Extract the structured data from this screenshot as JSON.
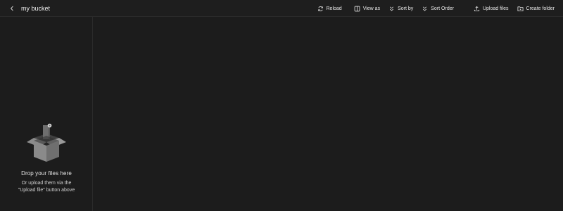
{
  "header": {
    "title": "my bucket",
    "actions": {
      "reload": "Reload",
      "view_as": "View as",
      "sort_by": "Sort by",
      "sort_order": "Sort Order",
      "upload_files": "Upload files",
      "create_folder": "Create folder"
    }
  },
  "sidebar": {
    "dropzone": {
      "title": "Drop your files here",
      "subtitle": "Or upload them via the \"Upload file\" button above"
    }
  }
}
